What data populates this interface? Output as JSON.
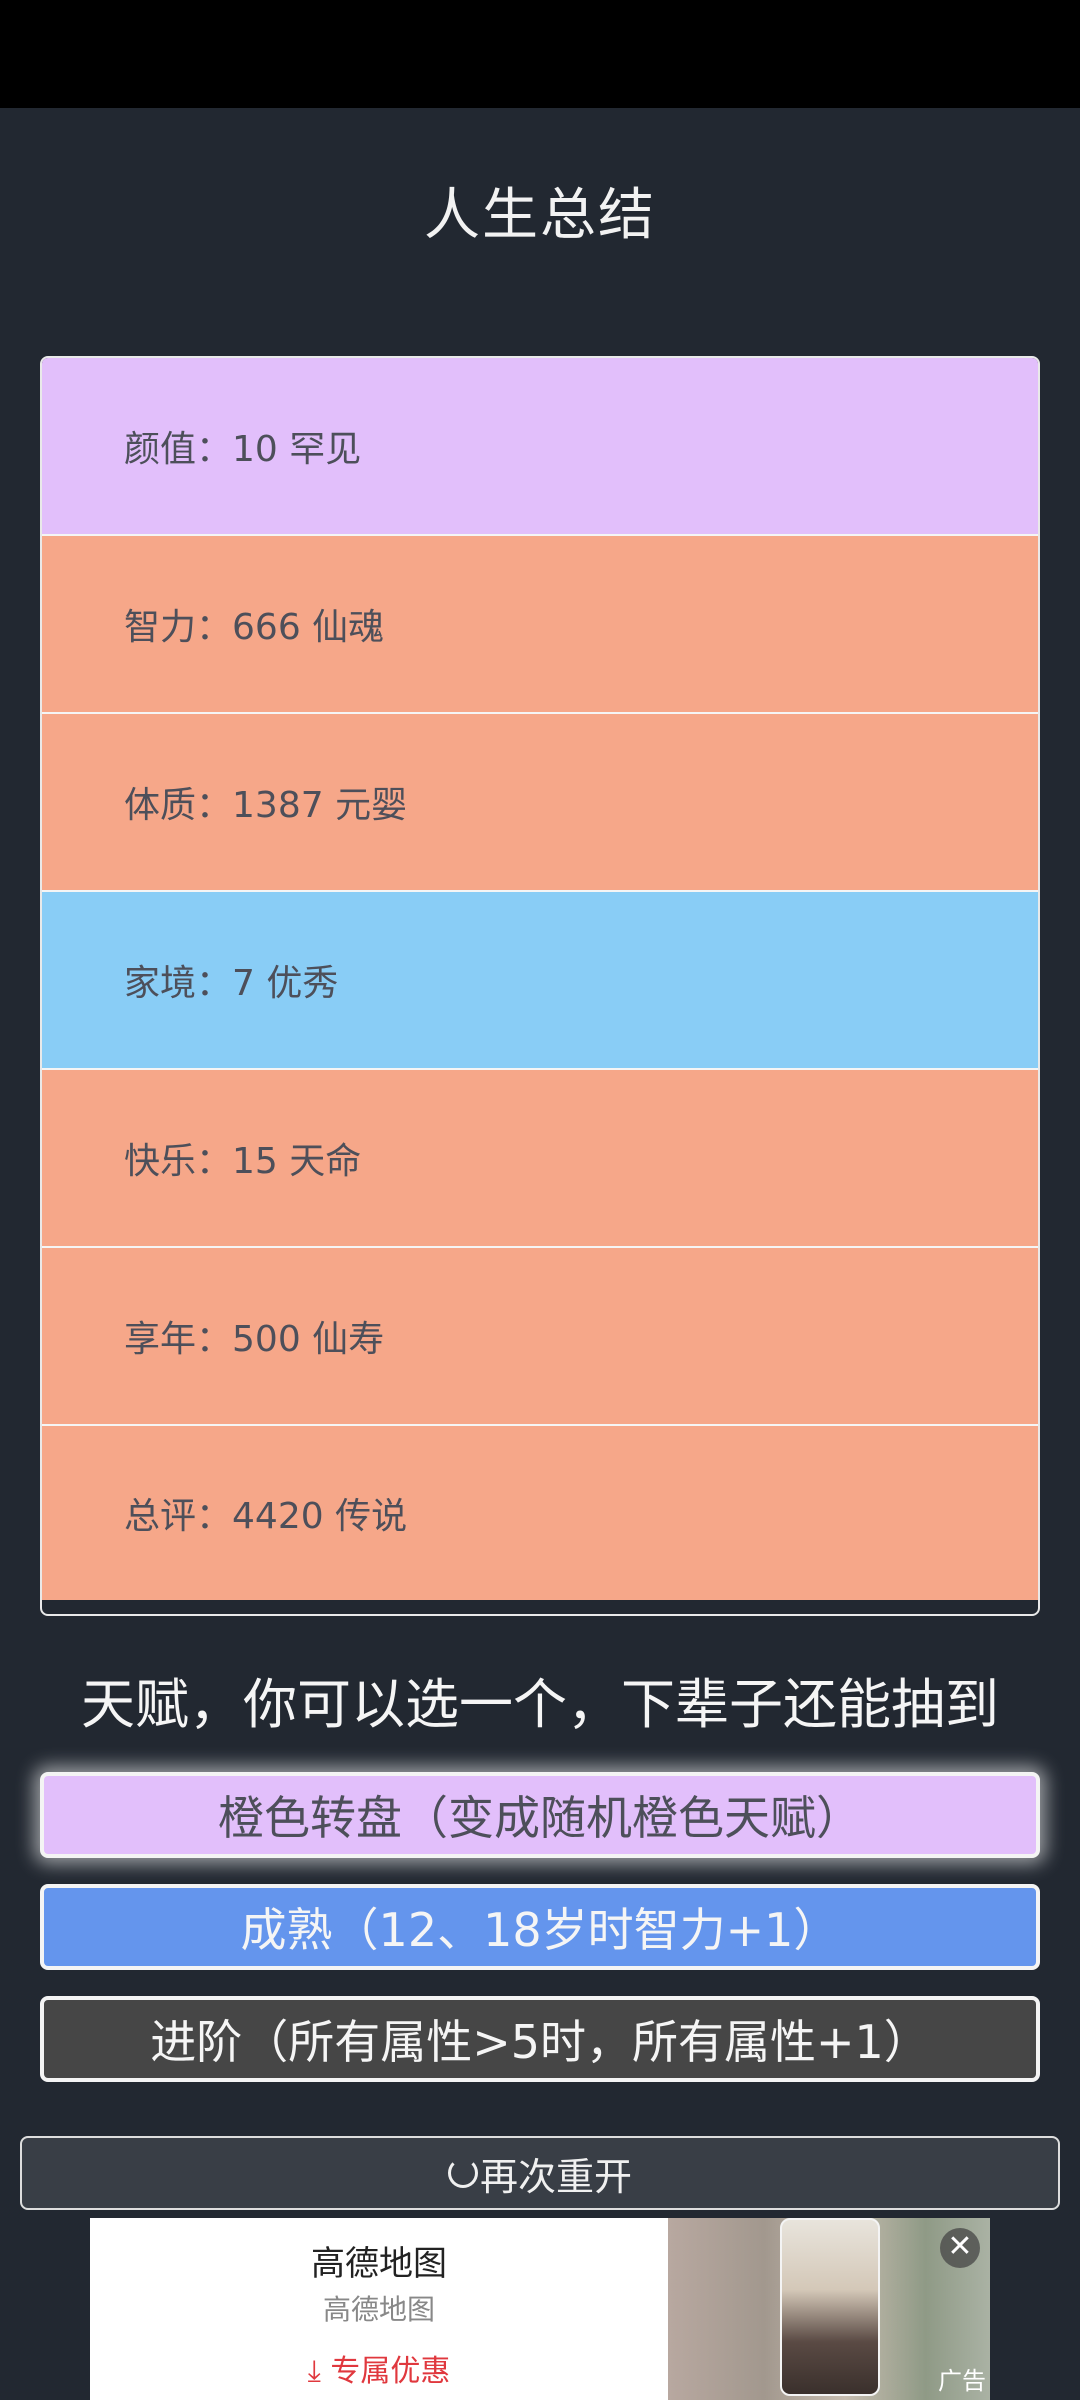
{
  "title": "人生总结",
  "summary": {
    "rows": [
      {
        "label": "颜值：",
        "value": "10 罕见",
        "color": "#e2bffb"
      },
      {
        "label": "智力：",
        "value": "666 仙魂",
        "color": "#f6a789"
      },
      {
        "label": "体质：",
        "value": "1387 元婴",
        "color": "#f6a789"
      },
      {
        "label": "家境：",
        "value": "7 优秀",
        "color": "#89cdf6"
      },
      {
        "label": "快乐：",
        "value": "15 天命",
        "color": "#f6a789"
      },
      {
        "label": "享年：",
        "value": "500 仙寿",
        "color": "#f6a789"
      },
      {
        "label": "总评：",
        "value": "4420 传说",
        "color": "#f6a789"
      }
    ]
  },
  "talents": {
    "heading": "天赋，你可以选一个，下辈子还能抽到",
    "items": [
      {
        "label": "橙色转盘（变成随机橙色天赋）",
        "bg": "#e2bffb",
        "fg": "#4d4f5a",
        "selected": true
      },
      {
        "label": "成熟（12、18岁时智力+1）",
        "bg": "#6495ed",
        "fg": "#f5f5f5",
        "selected": false
      },
      {
        "label": "进阶（所有属性>5时，所有属性+1）",
        "bg": "#464646",
        "fg": "#f5f5f5",
        "selected": false
      }
    ]
  },
  "restart": {
    "label": "再次重开",
    "icon": "refresh-icon"
  },
  "ad": {
    "title": "高德地图",
    "subtitle": "高德地图",
    "cta": "专属优惠",
    "cta_icon": "download-arrow-icon",
    "badge": "广告",
    "close_icon": "close-icon"
  }
}
